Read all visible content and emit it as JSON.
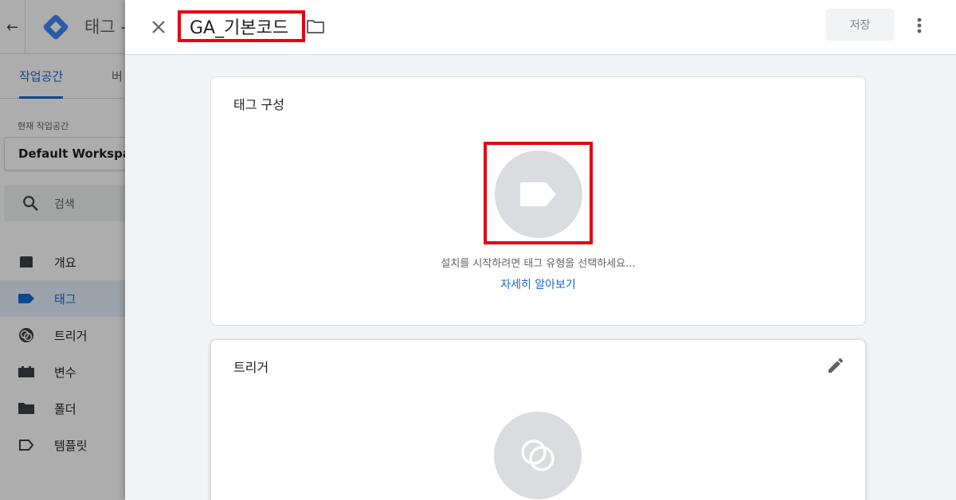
{
  "background_app": {
    "back_icon": "arrow-left-icon",
    "title": "태그 -",
    "tabs": [
      {
        "label": "작업공간",
        "active": true
      },
      {
        "label": "버"
      }
    ],
    "workspace_label": "현재 작업공간",
    "workspace_name": "Default Workspace",
    "search_placeholder": "검색",
    "nav_items": [
      {
        "label": "개요",
        "icon": "overview-icon"
      },
      {
        "label": "태그",
        "icon": "tag-icon",
        "active": true
      },
      {
        "label": "트리거",
        "icon": "trigger-icon"
      },
      {
        "label": "변수",
        "icon": "variable-icon"
      },
      {
        "label": "폴더",
        "icon": "folder-icon"
      },
      {
        "label": "템플릿",
        "icon": "template-icon"
      }
    ]
  },
  "sheet": {
    "title": "GA_기본코드",
    "save_label": "저장",
    "tag_config": {
      "title": "태그 구성",
      "hint": "설치를 시작하려면 태그 유형을 선택하세요...",
      "learn_more": "자세히 알아보기"
    },
    "trigger": {
      "title": "트리거"
    }
  },
  "colors": {
    "accent": "#1967d2",
    "highlight_border": "#e60012",
    "placeholder_circle": "#dadce0"
  }
}
